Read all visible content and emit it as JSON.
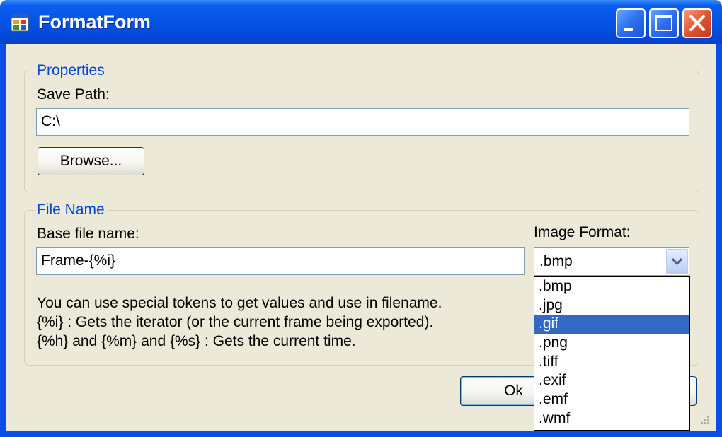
{
  "window": {
    "title": "FormatForm",
    "icon": "app-form-icon",
    "controls": [
      "minimize-icon",
      "maximize-icon",
      "close-icon"
    ],
    "colors": {
      "titlebar": "#0553e4",
      "client": "#ece9d8",
      "group_title": "#0046d5",
      "selection": "#316ac5"
    }
  },
  "properties_group": {
    "title": "Properties",
    "save_path_label": "Save Path:",
    "save_path_value": "C:\\",
    "browse_label": "Browse..."
  },
  "filename_group": {
    "title": "File Name",
    "base_label": "Base file name:",
    "base_value": "Frame-{%i}",
    "format_label": "Image Format:",
    "format_value": ".bmp",
    "help_line1": "You can use special tokens to get values and use in filename.",
    "help_line2": "{%i} : Gets the iterator (or the current frame being exported).",
    "help_line3": "{%h} and {%m} and {%s} : Gets the current time."
  },
  "dropdown": {
    "items": [
      ".bmp",
      ".jpg",
      ".gif",
      ".png",
      ".tiff",
      ".exif",
      ".emf",
      ".wmf"
    ],
    "highlighted": ".gif"
  },
  "footer": {
    "ok_label": "Ok"
  }
}
